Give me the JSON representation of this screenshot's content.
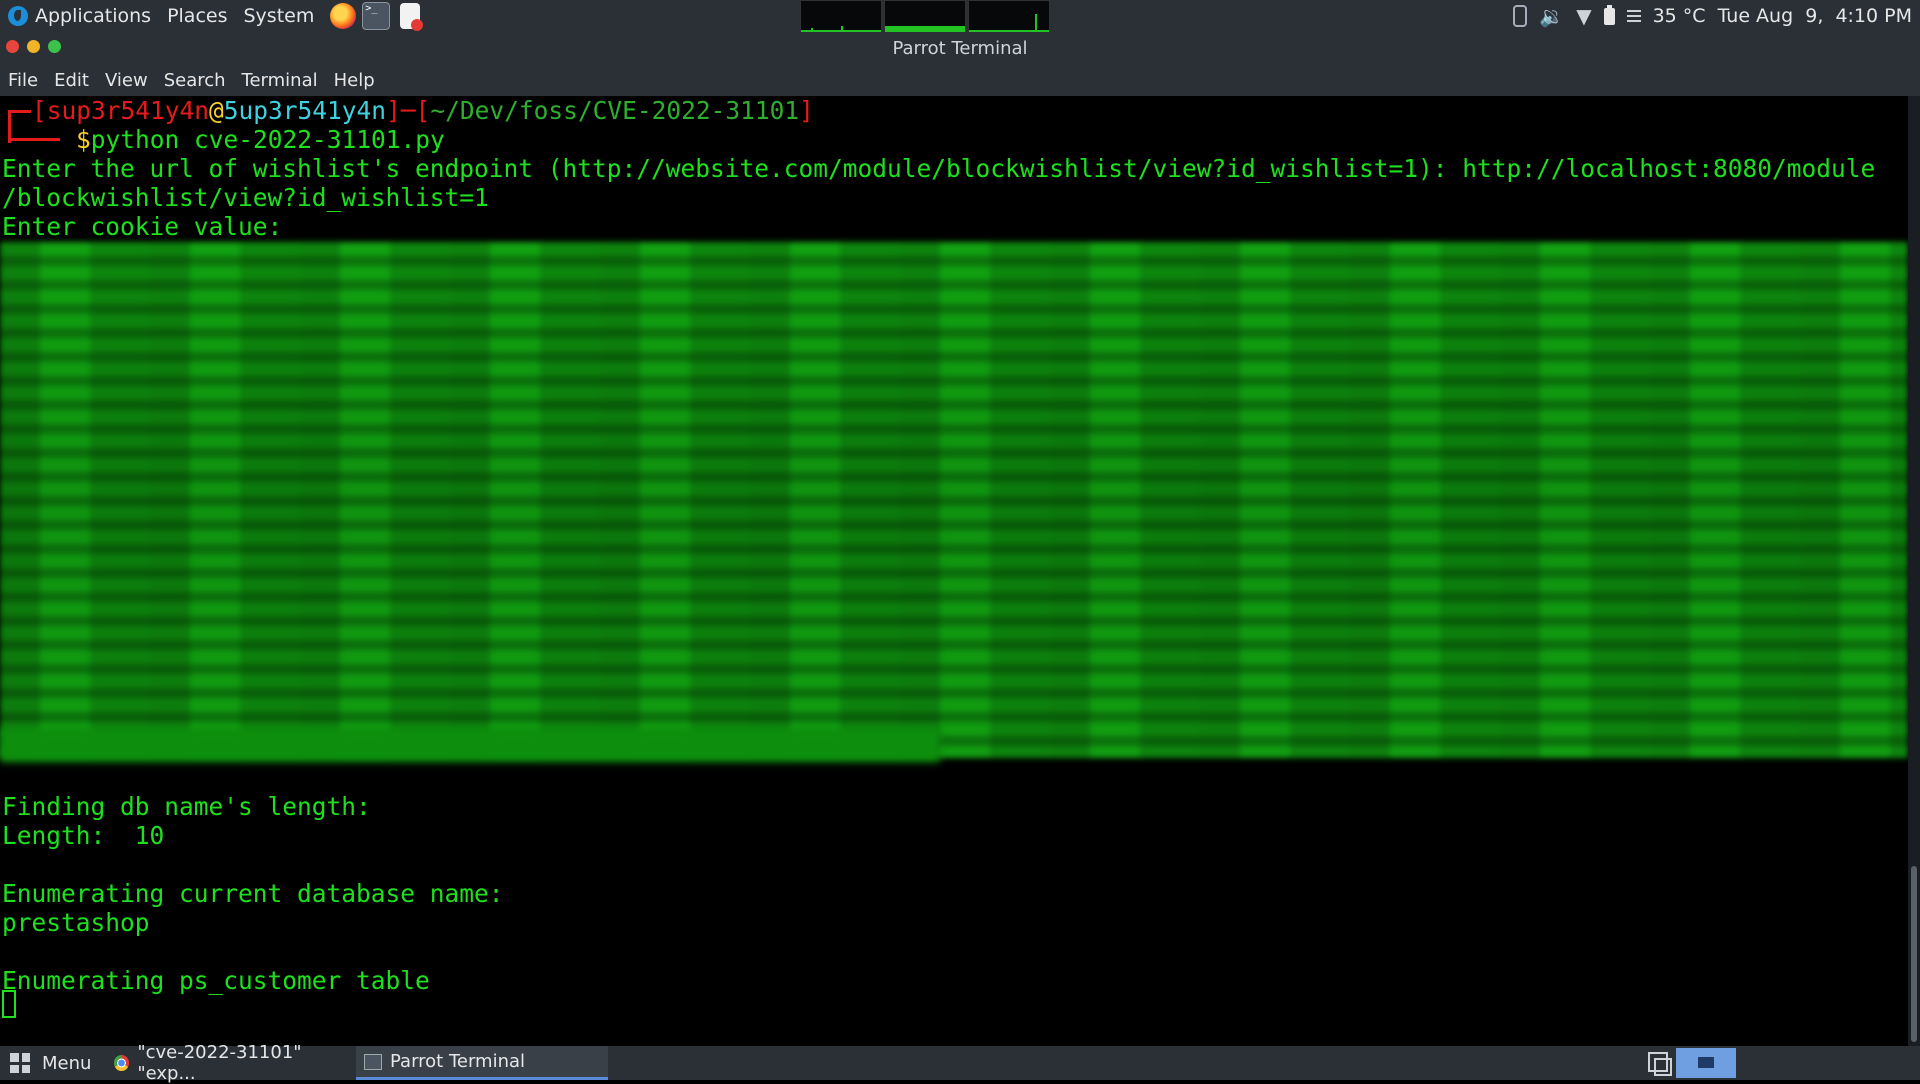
{
  "top_panel": {
    "menu": [
      "Applications",
      "Places",
      "System"
    ],
    "launchers": [
      "firefox-icon",
      "terminal-icon",
      "text-editor-icon"
    ],
    "system_monitor_levels": [
      0.05,
      0.2,
      0.05
    ],
    "temperature": "35 °C",
    "datetime": "Tue Aug  9,  4:10 PM",
    "tray_icons": [
      "bluetooth-icon",
      "volume-icon",
      "wifi-icon",
      "battery-icon",
      "temperature-icon"
    ]
  },
  "window": {
    "title": "Parrot Terminal"
  },
  "menu_bar": [
    "File",
    "Edit",
    "View",
    "Search",
    "Terminal",
    "Help"
  ],
  "terminal": {
    "prompt_user": "sup3r541y4n",
    "prompt_at": "@",
    "prompt_host": "5up3r541y4n",
    "prompt_path": "~/Dev/foss/CVE-2022-31101",
    "prompt_symbol": "$",
    "command": "python cve-2022-31101.py",
    "line_url_1": "Enter the url of wishlist's endpoint (http://website.com/module/blockwishlist/view?id_wishlist=1): http://localhost:8080/module",
    "line_url_2": "/blockwishlist/view?id_wishlist=1",
    "line_cookie": "Enter cookie value:",
    "line_find_len": "Finding db name's length:",
    "line_length": "Length:  10",
    "line_enum_db": "Enumerating current database name:",
    "line_db_name": "prestashop",
    "line_enum_table": "Enumerating ps_customer table"
  },
  "taskbar": {
    "menu_label": "Menu",
    "task_browser": "\"cve-2022-31101\" \"exp...",
    "task_terminal": "Parrot Terminal"
  },
  "colors": {
    "panel_bg": "#2b3037",
    "terminal_text": "#1ee01e",
    "prompt_red": "#e31b1b",
    "prompt_cyan": "#3fd1e0",
    "prompt_yellow": "#f7d02b"
  }
}
